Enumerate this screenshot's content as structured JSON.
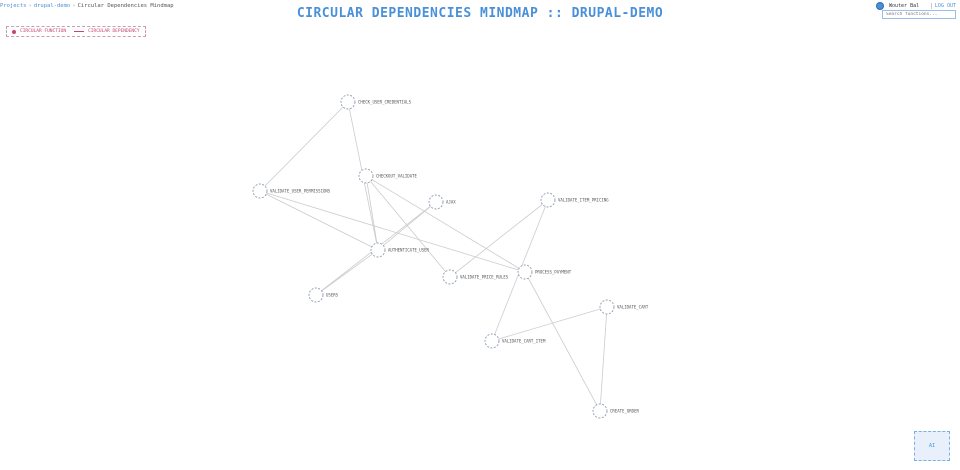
{
  "breadcrumb": {
    "projects": "Projects",
    "project": "drupal-demo",
    "current": "Circular Dependencies Mindmap",
    "separator": "›"
  },
  "page_title": "CIRCULAR DEPENDENCIES MINDMAP :: DRUPAL-DEMO",
  "user": {
    "name": "Wouter Bal",
    "logout_label": "LOG OUT"
  },
  "search": {
    "placeholder": "Search functions..."
  },
  "legend": {
    "function_label": "CIRCULAR FUNCTION",
    "dependency_label": "CIRCULAR DEPENDENCY"
  },
  "ai_button_label": "AI",
  "colors": {
    "accent": "#4a90d9",
    "legend": "#c7456a",
    "node_stroke": "#8a9bb0",
    "edge": "#cccccc"
  },
  "graph": {
    "nodes": [
      {
        "id": "check_user_credentials",
        "label": "CHECK_USER_CREDENTIALS"
      },
      {
        "id": "checkout_validate",
        "label": "CHECKOUT_VALIDATE"
      },
      {
        "id": "validate_user_permissions",
        "label": "VALIDATE_USER_PERMISSIONS"
      },
      {
        "id": "ajax",
        "label": "AJAX"
      },
      {
        "id": "authenticate_user",
        "label": "AUTHENTICATE_USER"
      },
      {
        "id": "users",
        "label": "USERS"
      },
      {
        "id": "validate_item_pricing",
        "label": "VALIDATE_ITEM_PRICING"
      },
      {
        "id": "validate_price_rules",
        "label": "VALIDATE_PRICE_RULES"
      },
      {
        "id": "process_payment",
        "label": "PROCESS_PAYMENT"
      },
      {
        "id": "validate_cart",
        "label": "VALIDATE_CART"
      },
      {
        "id": "validate_cart_item",
        "label": "VALIDATE_CART_ITEM"
      },
      {
        "id": "create_order",
        "label": "CREATE_ORDER"
      }
    ],
    "edges": [
      [
        "check_user_credentials",
        "validate_user_permissions"
      ],
      [
        "check_user_credentials",
        "authenticate_user"
      ],
      [
        "validate_user_permissions",
        "authenticate_user"
      ],
      [
        "checkout_validate",
        "authenticate_user"
      ],
      [
        "checkout_validate",
        "validate_price_rules"
      ],
      [
        "checkout_validate",
        "process_payment"
      ],
      [
        "ajax",
        "authenticate_user"
      ],
      [
        "ajax",
        "users"
      ],
      [
        "authenticate_user",
        "users"
      ],
      [
        "validate_item_pricing",
        "validate_price_rules"
      ],
      [
        "validate_item_pricing",
        "validate_cart_item"
      ],
      [
        "process_payment",
        "create_order"
      ],
      [
        "validate_cart",
        "validate_cart_item"
      ],
      [
        "validate_cart",
        "create_order"
      ],
      [
        "validate_user_permissions",
        "process_payment"
      ]
    ]
  }
}
